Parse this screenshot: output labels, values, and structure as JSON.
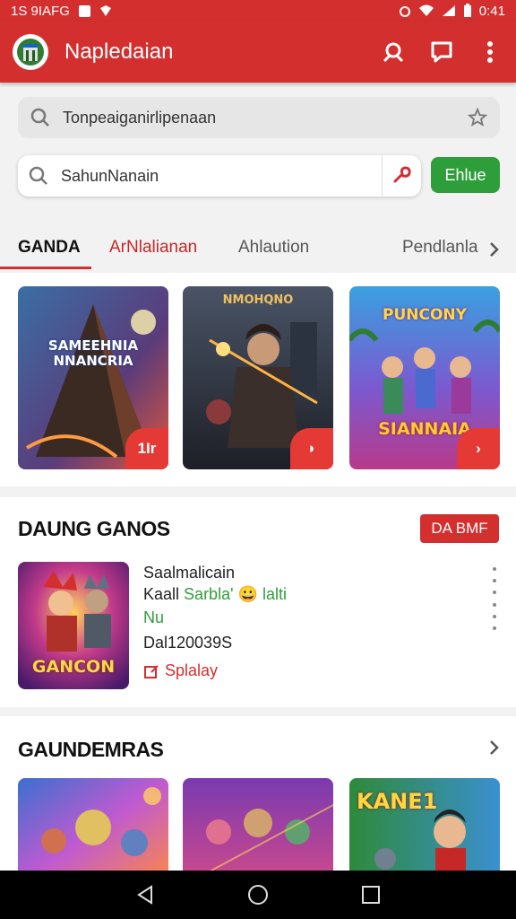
{
  "status_bar": {
    "time_left": "1S 9IAFG",
    "time_right": "0:41"
  },
  "app": {
    "title": "Napledaian"
  },
  "search": {
    "primary_text": "Tonpeaiganirlipenaan",
    "secondary_text": "SahunNanain",
    "go_label": "Ehlue"
  },
  "tabs": [
    {
      "label": "GANDA"
    },
    {
      "label": "ArNlalianan"
    },
    {
      "label": "Ahlaution"
    },
    {
      "label": "Pendlanla"
    }
  ],
  "game_cards": [
    {
      "title": "SAMEEHNIA NNANCRIA",
      "badge": "1Ir"
    },
    {
      "title": "NMOHQNO",
      "badge": "◗"
    },
    {
      "title": "PUNCONY",
      "subtitle": "SIANNAIA",
      "badge": "›"
    }
  ],
  "featured": {
    "section_title": "DAUNG GANOS",
    "badge": "DA BMF",
    "game_logo": "GANCON",
    "line1": "Saalmalicain",
    "line2_black": "Kaall",
    "line2_green": "Sarbla' ",
    "line2_emoji": "😀",
    "line2_green_end": " lalti",
    "line3_green": "Nu",
    "line4": "Dal120039S",
    "action": "Splalay",
    "colors": {
      "green": "#2e9e3a",
      "red": "#d32f2f"
    }
  },
  "section3": {
    "title": "GAUNDEMRAS",
    "cards": [
      {
        "title": ""
      },
      {
        "title": ""
      },
      {
        "title": "KANE1"
      }
    ]
  },
  "icons": [
    "app-logo-icon",
    "search-icon",
    "star-icon",
    "mic-icon",
    "share-icon",
    "chat-icon",
    "more-icon",
    "chevron-right-icon",
    "back-icon",
    "home-icon",
    "recents-icon"
  ]
}
